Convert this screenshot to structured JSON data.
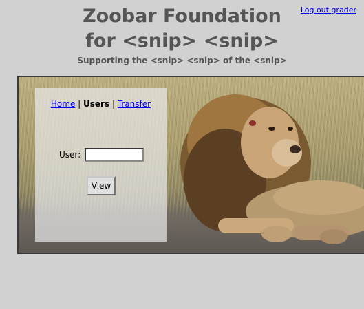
{
  "header": {
    "logout_label": "Log out grader",
    "title_line1": "Zoobar Foundation",
    "title_line2": "for <snip> <snip>",
    "subtitle": "Supporting the <snip> <snip> of the <snip>"
  },
  "nav": {
    "home": "Home",
    "users": "Users",
    "transfer": "Transfer",
    "separator": "|"
  },
  "form": {
    "user_label": "User:",
    "user_value": "",
    "view_label": "View"
  },
  "banner": {
    "image_icon": "lion-photo"
  }
}
